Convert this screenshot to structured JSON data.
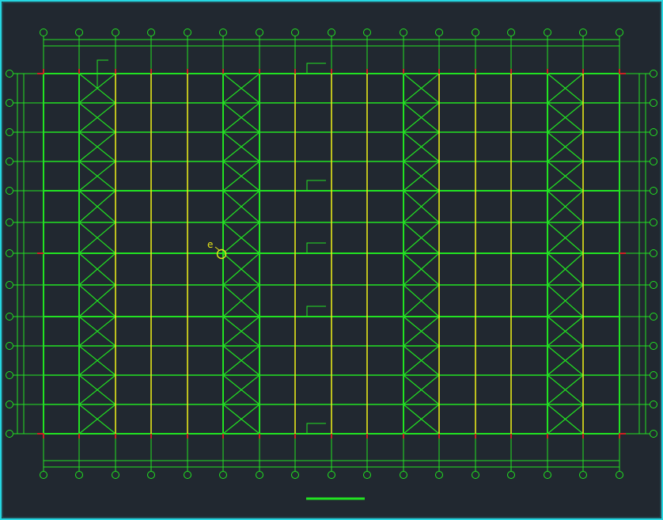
{
  "drawing": {
    "type": "steel-roof-framing-plan",
    "colors": {
      "background": "#212830",
      "border": "#25d7e2",
      "green": "#22e222",
      "yellow": "#e6e619",
      "red": "#cc2222",
      "axis_bubble": "#22e222"
    },
    "grid": {
      "columns": 17,
      "rows": 13,
      "bay_rows_with_purlins": [
        0,
        1,
        2,
        3,
        4,
        5,
        6,
        7,
        8,
        9,
        10,
        11,
        12
      ],
      "braced_bay_pairs": [
        [
          1,
          2
        ],
        [
          5,
          6
        ],
        [
          10,
          11
        ],
        [
          14,
          15
        ]
      ],
      "main_rafter_rows": [
        0,
        4,
        6,
        8,
        12
      ],
      "yellow_column_lines": [
        2,
        3,
        4,
        7,
        8,
        9,
        11,
        12,
        13,
        15
      ]
    },
    "marker": {
      "label": "e"
    },
    "section_tags": [
      0,
      4,
      6,
      8,
      12
    ],
    "scale_bar": true
  }
}
